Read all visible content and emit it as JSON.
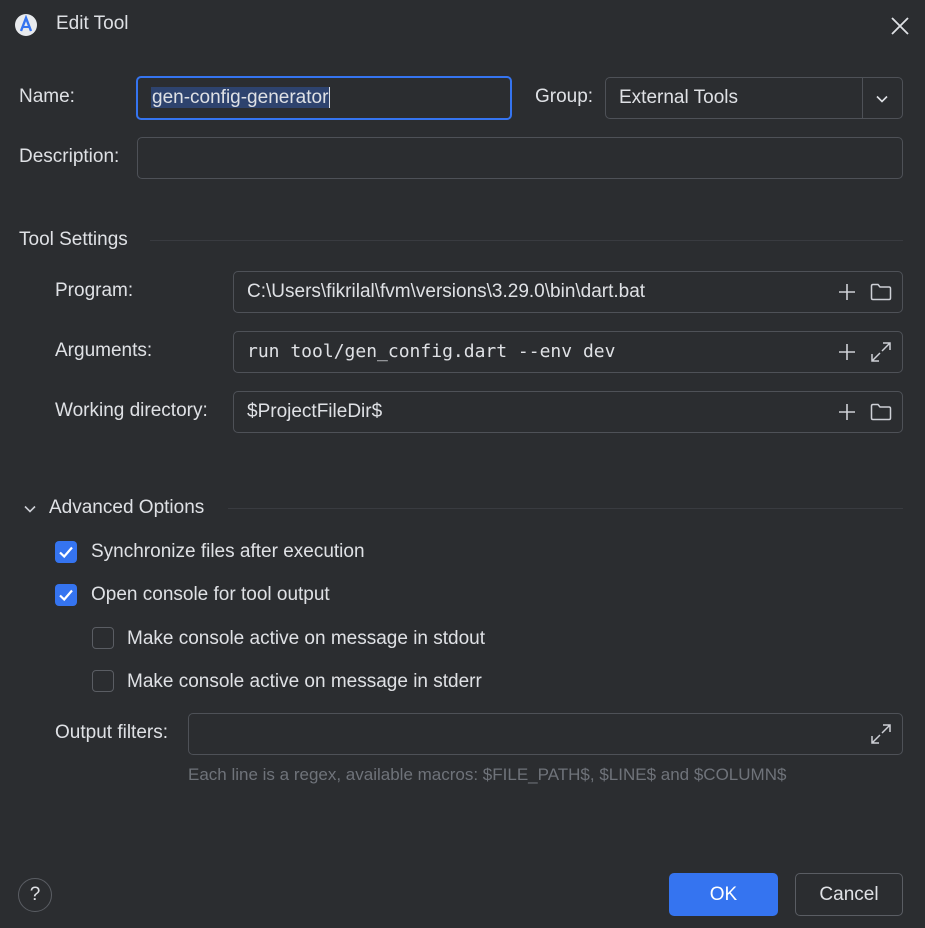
{
  "dialog": {
    "title": "Edit Tool",
    "app_icon": "android-studio-icon",
    "close_icon": "close-icon"
  },
  "form": {
    "name_label": "Name:",
    "name_value": "gen-config-generator",
    "group_label": "Group:",
    "group_value": "External Tools",
    "description_label": "Description:",
    "description_value": ""
  },
  "tool_settings": {
    "heading": "Tool Settings",
    "program_label": "Program:",
    "program_value": "C:\\Users\\fikrilal\\fvm\\versions\\3.29.0\\bin\\dart.bat",
    "arguments_label": "Arguments:",
    "arguments_value": "run tool/gen_config.dart --env dev",
    "working_dir_label": "Working directory:",
    "working_dir_value": "$ProjectFileDir$"
  },
  "advanced": {
    "heading": "Advanced Options",
    "expanded": true,
    "sync_files": {
      "label": "Synchronize files after execution",
      "checked": true
    },
    "open_console": {
      "label": "Open console for tool output",
      "checked": true
    },
    "active_stdout": {
      "label": "Make console active on message in stdout",
      "checked": false
    },
    "active_stderr": {
      "label": "Make console active on message in stderr",
      "checked": false
    },
    "output_filters_label": "Output filters:",
    "output_filters_value": "",
    "output_filters_hint": "Each line is a regex, available macros: $FILE_PATH$, $LINE$ and $COLUMN$"
  },
  "footer": {
    "help": "?",
    "ok": "OK",
    "cancel": "Cancel"
  },
  "colors": {
    "background": "#2b2d30",
    "accent": "#3574f0",
    "selection": "#2e436e",
    "border": "#4e5157",
    "hint": "#6f737a"
  }
}
